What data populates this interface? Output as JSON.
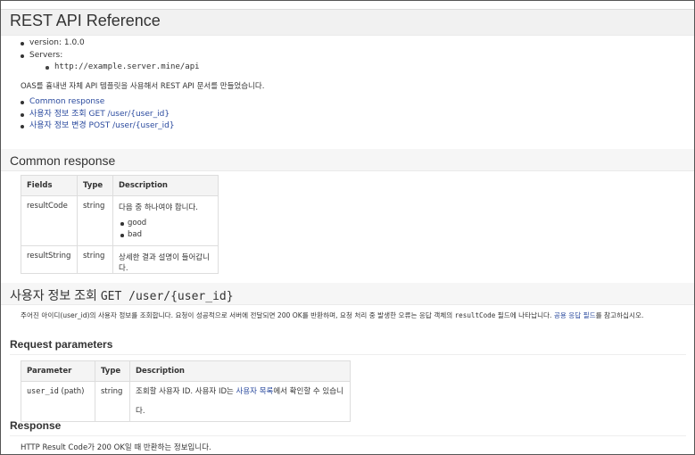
{
  "title": "REST API Reference",
  "info": {
    "version": "version: 1.0.0",
    "servers_label": "Servers:",
    "server_url": "http://example.server.mine/api"
  },
  "description": "OAS를 흉내낸 자체 API 템플릿을 사용해서 REST API 문서를 만들었습니다.",
  "toc": [
    "Common response",
    "사용자 정보 조회 GET /user/{user_id}",
    "사용자 정보 변경 POST /user/{user_id}"
  ],
  "common": {
    "heading": "Common response",
    "headers": [
      "Fields",
      "Type",
      "Description"
    ],
    "rows": [
      {
        "field": "resultCode",
        "type": "string",
        "desc": "다음 중 하나여야 합니다.",
        "options": [
          "good",
          "bad"
        ]
      },
      {
        "field": "resultString",
        "type": "string",
        "desc": "상세한 결과 설명이 들어갑니다."
      }
    ]
  },
  "endpoint": {
    "heading_text": "사용자 정보 조회 ",
    "heading_code": "GET /user/{user_id}",
    "desc_a": "주어진 아이디(user_id)의 사용자 정보를 조회합니다. 요청이 성공적으로 서버에 전달되면 200 OK를 반환하며, 요청 처리 중 발생한 오류는 응답 객체의 ",
    "desc_code": "resultCode",
    "desc_b": " 필드에 나타납니다. ",
    "desc_link": "공용 응답 필드",
    "desc_c": "를 참고하십시오.",
    "params_heading": "Request parameters",
    "params_headers": [
      "Parameter",
      "Type",
      "Description"
    ],
    "params_rows": [
      {
        "name": "user_id",
        "loc": " (path)",
        "type": "string",
        "desc_a": "조회할 사용자 ID. 사용자 ID는 ",
        "desc_link": "사용자 목록",
        "desc_b": "에서 확인할 수 있습니다."
      }
    ],
    "response_heading": "Response",
    "response_text": "HTTP Result Code가 200 OK일 때 반환하는 정보입니다."
  },
  "colors": {
    "link": "#2a4a9e",
    "header_bg": "#f1f1f1",
    "border": "#dddddd"
  }
}
